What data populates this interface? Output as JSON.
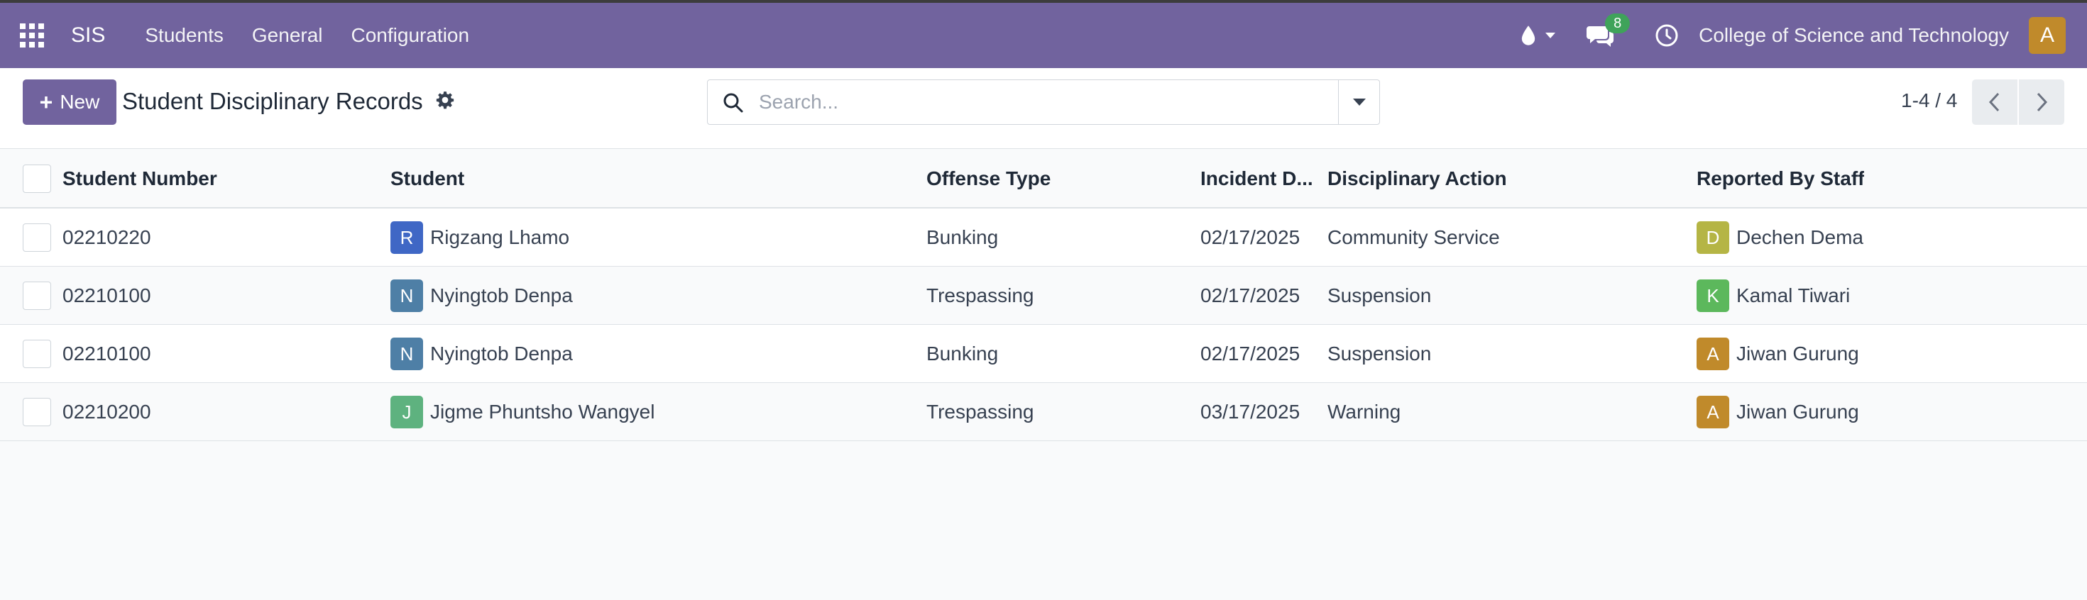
{
  "navbar": {
    "brand": "SIS",
    "menu": [
      "Students",
      "General",
      "Configuration"
    ],
    "chat_count": "8",
    "company": "College of Science and Technology",
    "user_initial": "A"
  },
  "control_panel": {
    "new_label": "New",
    "title": "Student Disciplinary Records",
    "search_placeholder": "Search...",
    "pager": "1-4 / 4"
  },
  "table": {
    "columns": {
      "student_number": "Student Number",
      "student": "Student",
      "offense_type": "Offense Type",
      "incident_date": "Incident D...",
      "disciplinary_action": "Disciplinary Action",
      "reported_by": "Reported By Staff"
    },
    "rows": [
      {
        "number": "02210220",
        "student_initial": "R",
        "student": "Rigzang Lhamo",
        "offense": "Bunking",
        "date": "02/17/2025",
        "action": "Community Service",
        "staff_initial": "D",
        "staff": "Dechen Dema"
      },
      {
        "number": "02210100",
        "student_initial": "N",
        "student": "Nyingtob Denpa",
        "offense": "Trespassing",
        "date": "02/17/2025",
        "action": "Suspension",
        "staff_initial": "K",
        "staff": "Kamal Tiwari"
      },
      {
        "number": "02210100",
        "student_initial": "N",
        "student": "Nyingtob Denpa",
        "offense": "Bunking",
        "date": "02/17/2025",
        "action": "Suspension",
        "staff_initial": "A",
        "staff": "Jiwan Gurung"
      },
      {
        "number": "02210200",
        "student_initial": "J",
        "student": "Jigme Phuntsho Wangyel",
        "offense": "Trespassing",
        "date": "03/17/2025",
        "action": "Warning",
        "staff_initial": "A",
        "staff": "Jiwan Gurung"
      }
    ]
  },
  "colors": {
    "navbar": "#71639e",
    "primary_button": "#71639e",
    "avatar_r": "#3f67c5",
    "avatar_n": "#4e7fa6",
    "avatar_j": "#5eb27f",
    "avatar_d": "#b5b545",
    "avatar_k": "#5cb85c",
    "avatar_a": "#c08a2b"
  }
}
